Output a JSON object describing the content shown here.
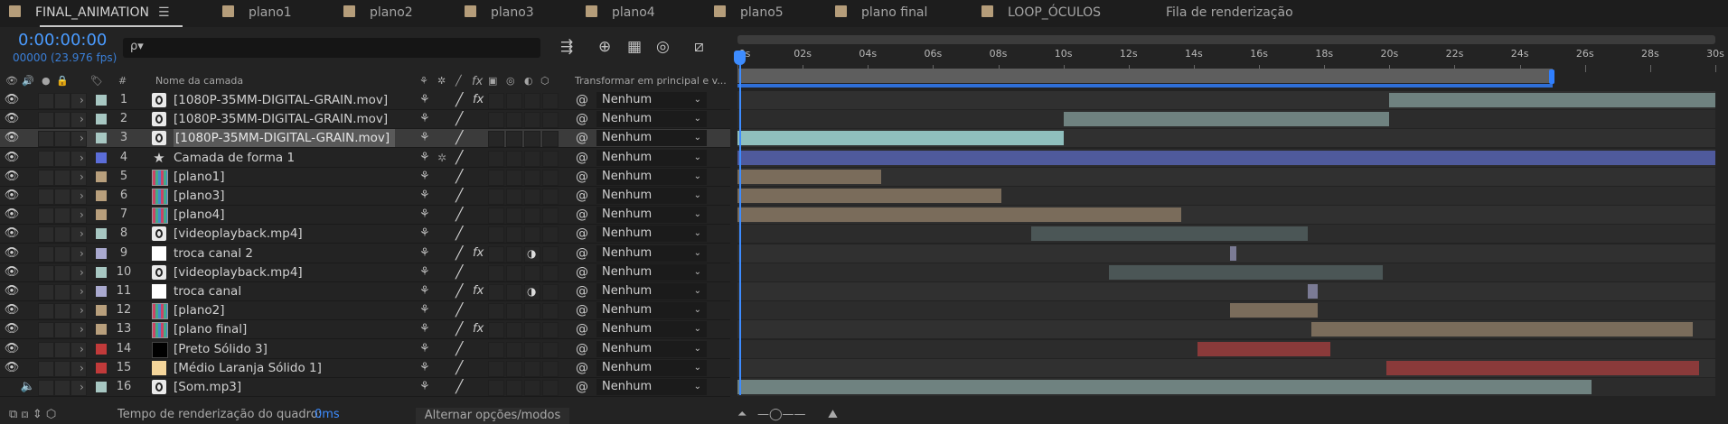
{
  "tabs": [
    {
      "label": "FINAL_ANIMATION",
      "active": true,
      "menu": "☰"
    },
    {
      "label": "plano1"
    },
    {
      "label": "plano2"
    },
    {
      "label": "plano3"
    },
    {
      "label": "plano4"
    },
    {
      "label": "plano5"
    },
    {
      "label": "plano final"
    },
    {
      "label": "LOOP_ÓCULOS"
    },
    {
      "label": "Fila de renderização",
      "noswatch": true
    }
  ],
  "composition": {
    "timecode": "0:00:00:00",
    "frames": "00000 (23.976 fps)",
    "search_placeholder": "ρ▾"
  },
  "columns": {
    "number": "#",
    "name": "Nome da camada",
    "parent": "Transformar em principal e v..."
  },
  "ruler": {
    "ticks": [
      "0s",
      "02s",
      "04s",
      "06s",
      "08s",
      "10s",
      "12s",
      "14s",
      "16s",
      "18s",
      "20s",
      "22s",
      "24s",
      "26s",
      "28s",
      "30s"
    ],
    "duration": 30,
    "work_area_end": 25
  },
  "layers": [
    {
      "num": "1",
      "name": "[1080P-35MM-DIGITAL-GRAIN.mov]",
      "label": "#a7c7c2",
      "type": "footage",
      "fx": true,
      "parent": "Nenhum",
      "bar": {
        "in": 20,
        "out": 30,
        "color": "#6f8280"
      }
    },
    {
      "num": "2",
      "name": "[1080P-35MM-DIGITAL-GRAIN.mov]",
      "label": "#a7c7c2",
      "type": "footage",
      "parent": "Nenhum",
      "bar": {
        "in": 10,
        "out": 20,
        "color": "#6f8280"
      }
    },
    {
      "num": "3",
      "name": "[1080P-35MM-DIGITAL-GRAIN.mov]",
      "label": "#a7c7c2",
      "type": "footage",
      "parent": "Nenhum",
      "selected": true,
      "bar": {
        "in": 0,
        "out": 10,
        "color": "#8fbfbd"
      }
    },
    {
      "num": "4",
      "name": "Camada de forma 1",
      "label": "#5b6dd8",
      "type": "shape",
      "parent": "Nenhum",
      "bar": {
        "in": 0,
        "out": 30,
        "color": "#4f5a9c"
      }
    },
    {
      "num": "5",
      "name": "[plano1]",
      "label": "#b89f7c",
      "type": "comp",
      "parent": "Nenhum",
      "bar": {
        "in": 0,
        "out": 4.4,
        "color": "#7a6c5b"
      }
    },
    {
      "num": "6",
      "name": "[plano3]",
      "label": "#b89f7c",
      "type": "comp",
      "parent": "Nenhum",
      "bar": {
        "in": 0,
        "out": 8.1,
        "color": "#7a6c5b"
      }
    },
    {
      "num": "7",
      "name": "[plano4]",
      "label": "#b89f7c",
      "type": "comp",
      "parent": "Nenhum",
      "bar": {
        "in": 0,
        "out": 13.6,
        "color": "#7a6c5b"
      }
    },
    {
      "num": "8",
      "name": "[videoplayback.mp4]",
      "label": "#a7c7c2",
      "type": "footage",
      "parent": "Nenhum",
      "bar": {
        "in": 9,
        "out": 17.5,
        "color": "#4b5656"
      }
    },
    {
      "num": "9",
      "name": "troca canal 2",
      "label": "#a9a9cf",
      "type": "solid-white",
      "fx": true,
      "mb": true,
      "parent": "Nenhum",
      "bar": {
        "in": 15.1,
        "out": 15.3,
        "color": "#7b7b95"
      }
    },
    {
      "num": "10",
      "name": "[videoplayback.mp4]",
      "label": "#a7c7c2",
      "type": "footage",
      "parent": "Nenhum",
      "bar": {
        "in": 11.4,
        "out": 19.8,
        "color": "#4b5656"
      }
    },
    {
      "num": "11",
      "name": "troca canal",
      "label": "#a9a9cf",
      "type": "solid-white",
      "fx": true,
      "mb": true,
      "parent": "Nenhum",
      "bar": {
        "in": 17.5,
        "out": 17.8,
        "color": "#7b7b95"
      }
    },
    {
      "num": "12",
      "name": "[plano2]",
      "label": "#b89f7c",
      "type": "comp",
      "parent": "Nenhum",
      "bar": {
        "in": 15.1,
        "out": 17.8,
        "color": "#7a6c5b"
      }
    },
    {
      "num": "13",
      "name": "[plano final]",
      "label": "#b89f7c",
      "type": "comp",
      "fx": true,
      "parent": "Nenhum",
      "bar": {
        "in": 17.6,
        "out": 29.3,
        "color": "#7a6c5b"
      }
    },
    {
      "num": "14",
      "name": "[Preto Sólido 3]",
      "label": "#c13a3a",
      "type": "solid-black",
      "parent": "Nenhum",
      "bar": {
        "in": 14.1,
        "out": 18.2,
        "color": "#8a3a3a"
      }
    },
    {
      "num": "15",
      "name": "[Médio Laranja Sólido 1]",
      "label": "#c13a3a",
      "type": "solid-orange",
      "parent": "Nenhum",
      "bar": {
        "in": 19.9,
        "out": 29.5,
        "color": "#8a3a3a"
      }
    },
    {
      "num": "16",
      "name": "[Som.mp3]",
      "label": "#a7c7c2",
      "type": "footage",
      "audio": true,
      "parent": "Nenhum",
      "bar": {
        "in": 0,
        "out": 26.2,
        "color": "#6f8280"
      }
    }
  ],
  "bottom": {
    "render_time_label": "Tempo de renderização do quadro:",
    "render_time_value": "0ms",
    "toggle": "Alternar opções/modos"
  }
}
